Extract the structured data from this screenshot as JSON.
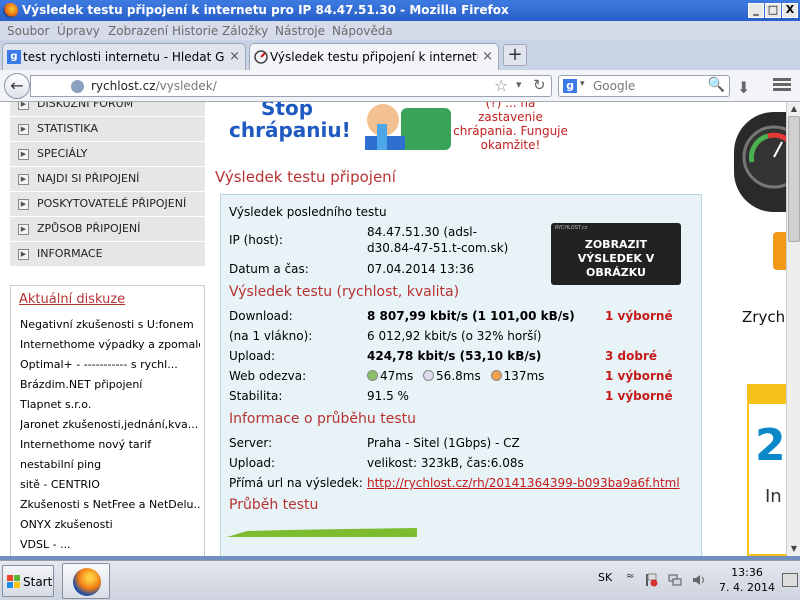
{
  "window": {
    "title": "Výsledek testu připojení k internetu pro IP 84.47.51.30 - Mozilla Firefox",
    "min": "_",
    "max": "□",
    "close": "X"
  },
  "menu": [
    "Soubor",
    "Úpravy",
    "Zobrazení",
    "Historie",
    "Záložky",
    "Nástroje",
    "Nápověda"
  ],
  "tabs": [
    {
      "label": "test rychlosti internetu - Hledat Googlem",
      "close": "×"
    },
    {
      "label": "Výsledek testu připojení k internetu pro I...",
      "close": "×"
    }
  ],
  "new_tab": "+",
  "nav": {
    "back": "←",
    "url_host": "rychlost.cz",
    "url_path": "/vysledek/",
    "star": "☆",
    "dropdown": "▾",
    "reload": "↻",
    "search_engine": "g",
    "search_placeholder": "Google",
    "search_icon": "🔍",
    "download_icon": "⬇"
  },
  "sidebar": {
    "items": [
      "DISKUZNÍ FÓRUM",
      "STATISTIKA",
      "SPECIÁLY",
      "NAJDI SI PŘIPOJENÍ",
      "POSKYTOVATELÉ PŘIPOJENÍ",
      "ZPŮSOB PŘIPOJENÍ",
      "INFORMACE"
    ],
    "arrow": "▶",
    "discussion_title": "Aktuální diskuze",
    "discussions": [
      "Negativní zkušenosti s U:fonem",
      "Internethome výpadky a zpomale...",
      "Optimal+ - ----------- s rychl...",
      "Brázdim.NET připojení",
      "Tlapnet s.r.o.",
      "Jaronet zkušenosti,jednání,kva...",
      "Internethome nový tarif",
      "nestabilní ping",
      "sitě - CENTRIO",
      "Zkušenosti s NetFree a NetDelu...",
      "ONYX zkušenosti",
      "VDSL - ..."
    ]
  },
  "ad": {
    "line1": "Stop",
    "line2": "chrápaniu!",
    "text": "(?) ... na zastavenie chrápania. Funguje okamžite!"
  },
  "page_title": "Výsledek testu připojení",
  "result": {
    "last_test_label": "Výsledek posledního testu",
    "ip_label": "IP (host):",
    "ip_value_line1": "84.47.51.30 (adsl-",
    "ip_value_line2": "d30.84-47-51.t-com.sk)",
    "date_label": "Datum a čas:",
    "date_value": "07.04.2014 13:36",
    "image_button": "ZOBRAZIT VÝSLEDEK V OBRÁZKU",
    "image_brand": "RYCHLOST.cz",
    "section_speed": "Výsledek testu (rychlost, kvalita)",
    "download_label": "Download:",
    "download_value": "8 807,99 kbit/s (1 101,00 kB/s)",
    "download_rating": "1 výborné",
    "single_label": "(na 1 vlákno):",
    "single_value": "6 012,92 kbit/s (o 32% horší)",
    "upload_label": "Upload:",
    "upload_value": "424,78 kbit/s (53,10 kB/s)",
    "upload_rating": "3 dobré",
    "ping_label": "Web odezva:",
    "ping1": "47ms",
    "ping2": "56.8ms",
    "ping3": "137ms",
    "ping_rating": "1 výborné",
    "stability_label": "Stabilita:",
    "stability_value": "91.5 %",
    "stability_rating": "1 výborné",
    "section_info": "Informace o průběhu testu",
    "server_label": "Server:",
    "server_value": "Praha - Sitel (1Gbps) - CZ",
    "upload2_label": "Upload:",
    "upload2_value": "velikost: 323kB, čas:6.08s",
    "url_label": "Přímá url na výsledek:",
    "url_value": "http://rychlost.cz/rh/20141364399-b093ba9a6f.html",
    "section_progress": "Průběh testu"
  },
  "right_ad": {
    "text": "Zrych",
    "big": "2",
    "small": "In"
  },
  "taskbar": {
    "start": "Start",
    "lang": "SK",
    "time": "13:36",
    "date": "7. 4. 2014",
    "tray_up": "≈"
  },
  "colors": {
    "accent_red": "#b83232",
    "rating_red": "#c41a1a",
    "result_bg": "#e7f3f7",
    "titlebar_blue": "#2a5fc8"
  }
}
